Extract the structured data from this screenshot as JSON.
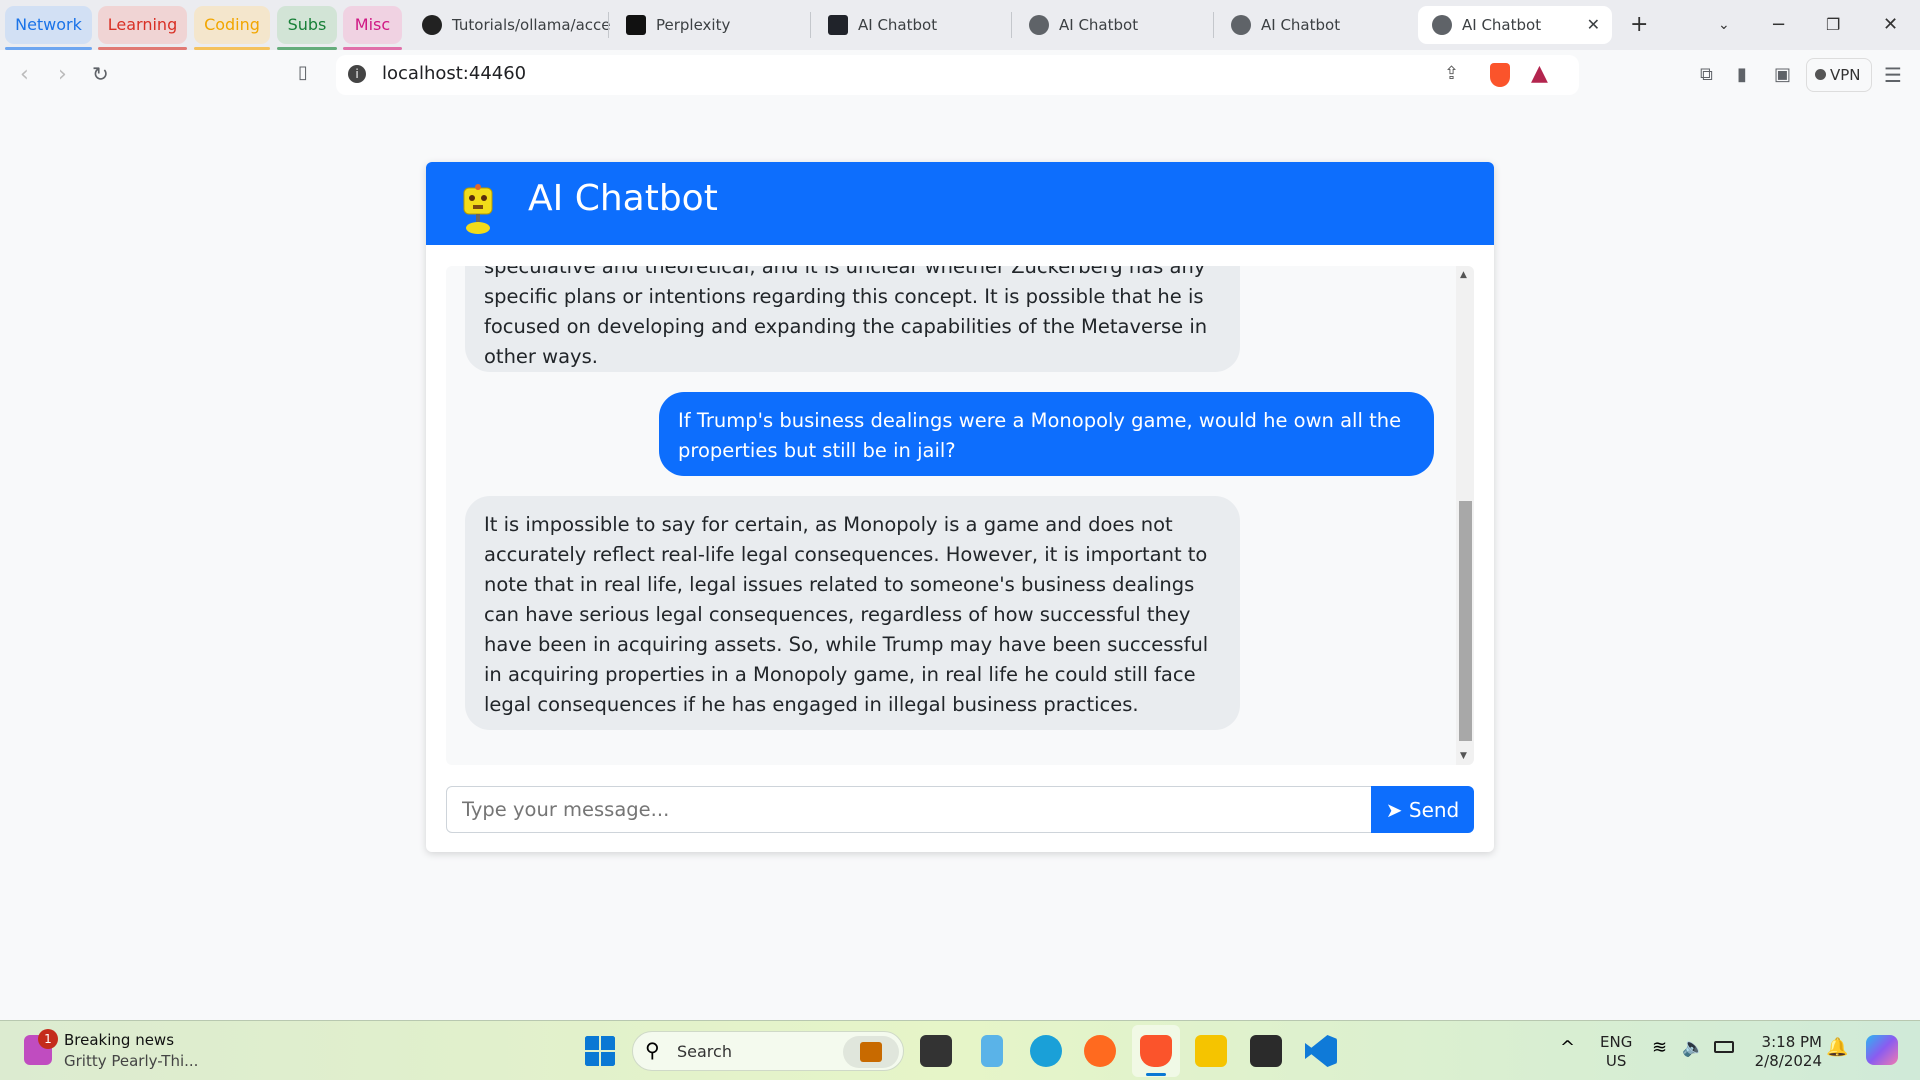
{
  "browser": {
    "tab_groups": [
      {
        "label": "Network",
        "color": "#1a73e8",
        "bg": "#d2e0f4",
        "underline": "#6ea6f0"
      },
      {
        "label": "Learning",
        "color": "#d93025",
        "bg": "#f0d4d4",
        "underline": "#e07a74"
      },
      {
        "label": "Coding",
        "color": "#f2a600",
        "bg": "#f4e6cc",
        "underline": "#f4c15c"
      },
      {
        "label": "Subs",
        "color": "#188038",
        "bg": "#d2e4d6",
        "underline": "#65ac7c"
      },
      {
        "label": "Misc",
        "color": "#d01884",
        "bg": "#f0d2e2",
        "underline": "#e070aa"
      }
    ],
    "tabs": [
      {
        "label": "Tutorials/ollama/acce"
      },
      {
        "label": "Perplexity"
      },
      {
        "label": "AI Chatbot"
      },
      {
        "label": "AI Chatbot"
      },
      {
        "label": "AI Chatbot"
      },
      {
        "label": "AI Chatbot",
        "active": true
      }
    ],
    "url": "localhost:44460",
    "vpn_label": "VPN"
  },
  "app": {
    "title": "AI Chatbot",
    "accent": "#0d6efd",
    "messages": [
      {
        "role": "bot",
        "text": "speculative and theoretical, and it is unclear whether Zuckerberg has any specific plans or intentions regarding this concept. It is possible that he is focused on developing and expanding the capabilities of the Metaverse in other ways."
      },
      {
        "role": "user",
        "text": "If Trump's business dealings were a Monopoly game, would he own all the properties but still be in jail?"
      },
      {
        "role": "bot",
        "text": "It is impossible to say for certain, as Monopoly is a game and does not accurately reflect real-life legal consequences. However, it is important to note that in real life, legal issues related to someone's business dealings can have serious legal consequences, regardless of how successful they have been in acquiring assets. So, while Trump may have been successful in acquiring properties in a Monopoly game, in real life he could still face legal consequences if he has engaged in illegal business practices."
      }
    ],
    "input_placeholder": "Type your message...",
    "send_label": "Send"
  },
  "taskbar": {
    "news_title": "Breaking news",
    "news_sub": "Gritty Pearly-Thi...",
    "news_badge": "1",
    "search_label": "Search",
    "lang1": "ENG",
    "lang2": "US",
    "time": "3:18 PM",
    "date": "2/8/2024"
  }
}
